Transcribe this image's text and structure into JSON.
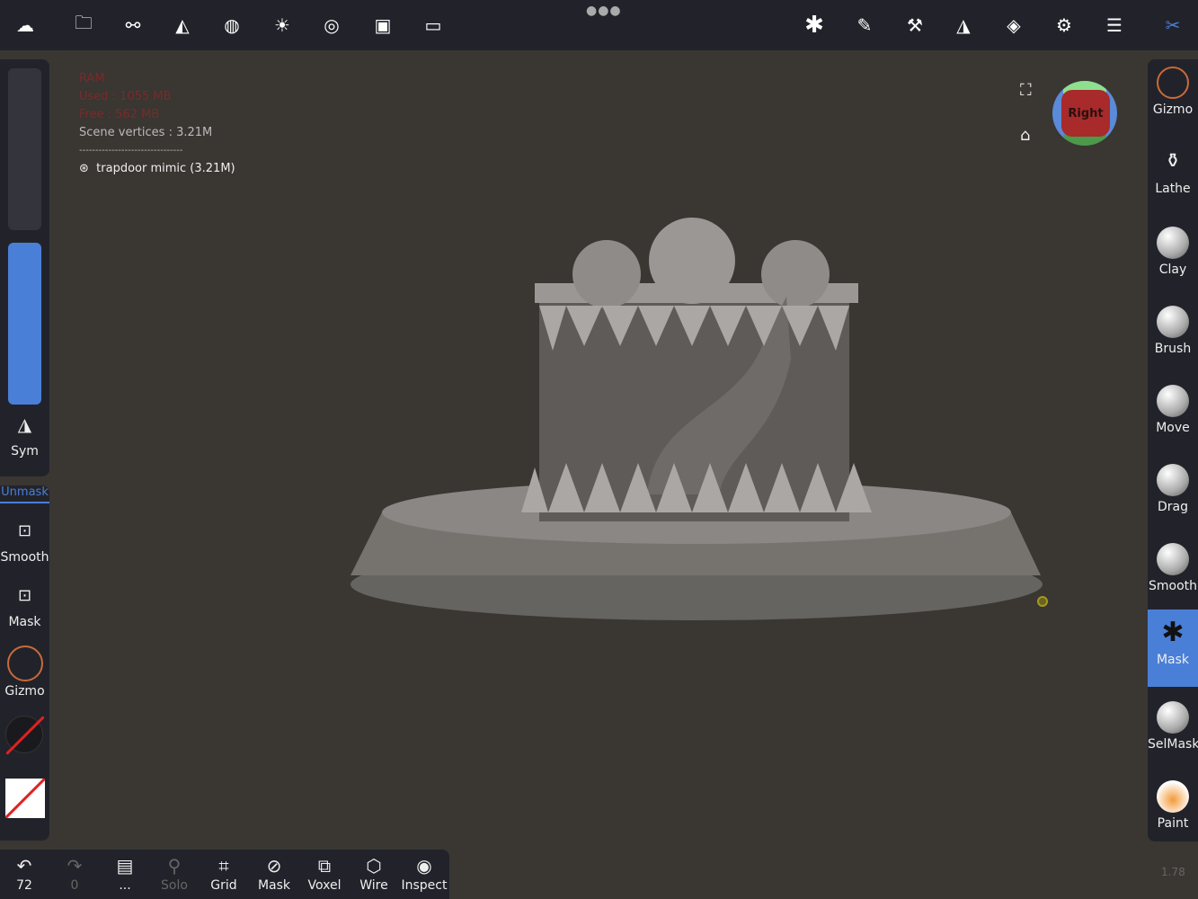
{
  "top_icons": [
    "nomad-logo-icon",
    "folder-icon",
    "share-nodes-icon",
    "scene-icon",
    "material-icon",
    "light-icon",
    "camera-aperture-icon",
    "image-icon",
    "video-icon"
  ],
  "top_right_icons": [
    "mask-tool-icon",
    "brush-icon",
    "hammer-icon",
    "symmetry-icon",
    "layers-icon",
    "gear-icon",
    "sliders-icon",
    "tools-icon"
  ],
  "info": {
    "ram": "RAM",
    "used": "Used : 1055 MB",
    "free": "Free : 562 MB",
    "vertices": "Scene vertices : 3.21M",
    "separator": "--------------------------------",
    "object": "trapdoor mimic (3.21M)"
  },
  "view_cube": {
    "label": "Right"
  },
  "left": {
    "sym": "Sym",
    "unmask": "Unmask",
    "smooth": "Smooth",
    "mask": "Mask",
    "gizmo": "Gizmo"
  },
  "right_tools": [
    {
      "label": "Gizmo"
    },
    {
      "label": "Lathe"
    },
    {
      "label": "Clay"
    },
    {
      "label": "Brush"
    },
    {
      "label": "Move"
    },
    {
      "label": "Drag"
    },
    {
      "label": "Smooth"
    },
    {
      "label": "Mask",
      "active": true
    },
    {
      "label": "SelMask"
    },
    {
      "label": "Paint"
    }
  ],
  "bottom": [
    {
      "label": "72",
      "icon": "undo-icon"
    },
    {
      "label": "0",
      "icon": "redo-icon",
      "disabled": true
    },
    {
      "label": "...",
      "icon": "book-icon"
    },
    {
      "label": "Solo",
      "icon": "search-icon",
      "disabled": true
    },
    {
      "label": "Grid",
      "icon": "grid-icon"
    },
    {
      "label": "Mask",
      "icon": "eye-slash-icon"
    },
    {
      "label": "Voxel",
      "icon": "cubes-icon"
    },
    {
      "label": "Wire",
      "icon": "wireframe-icon"
    },
    {
      "label": "Inspect",
      "icon": "inspect-icon"
    }
  ],
  "version": "1.78",
  "colors": {
    "accent": "#4a7fd8",
    "background": "#3a3632",
    "panel": "#22232a"
  }
}
